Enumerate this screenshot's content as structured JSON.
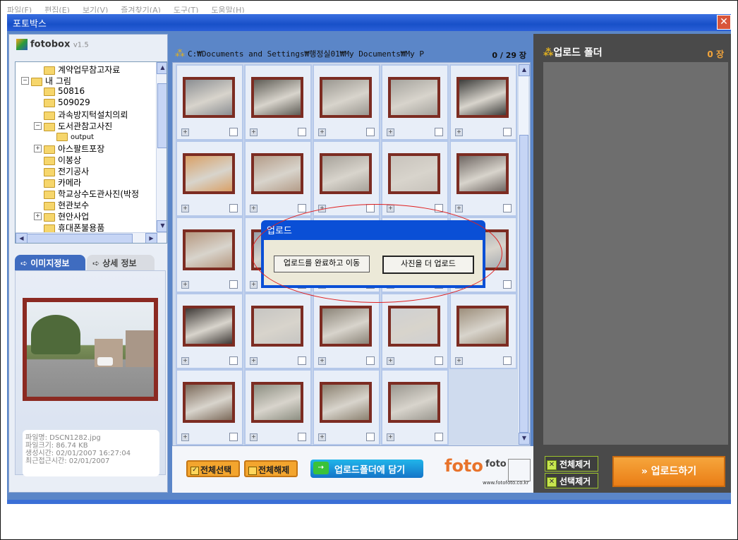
{
  "menubar": {
    "items": [
      "파일(F)",
      "편집(E)",
      "보기(V)",
      "즐겨찾기(A)",
      "도구(T)",
      "도움말(H)"
    ]
  },
  "window": {
    "title": "포토박스",
    "close_glyph": "✕"
  },
  "logo": {
    "name": "fotobox",
    "version": "v1.5"
  },
  "tree": {
    "items": [
      {
        "label": "계약업무참고자료",
        "indent": 2,
        "expander": ""
      },
      {
        "label": "내 그림",
        "indent": 1,
        "expander": "−"
      },
      {
        "label": "50816",
        "indent": 2,
        "expander": ""
      },
      {
        "label": "509029",
        "indent": 2,
        "expander": ""
      },
      {
        "label": "과속방지턱설치의뢰",
        "indent": 2,
        "expander": ""
      },
      {
        "label": "도서관참고사진",
        "indent": 2,
        "expander": "−"
      },
      {
        "label": "output",
        "indent": 3,
        "expander": ""
      },
      {
        "label": "아스팔트포장",
        "indent": 2,
        "expander": "+"
      },
      {
        "label": "이봉상",
        "indent": 2,
        "expander": ""
      },
      {
        "label": "전기공사",
        "indent": 2,
        "expander": ""
      },
      {
        "label": "카메라",
        "indent": 2,
        "expander": ""
      },
      {
        "label": "학교상수도관사진(박정",
        "indent": 2,
        "expander": ""
      },
      {
        "label": "현관보수",
        "indent": 2,
        "expander": ""
      },
      {
        "label": "현안사업",
        "indent": 2,
        "expander": "+"
      },
      {
        "label": "휴대폰불용품",
        "indent": 2,
        "expander": ""
      }
    ]
  },
  "tabs": {
    "image_info": "이미지정보",
    "detail_info": "상세 정보"
  },
  "file_info": {
    "name_label": "파일명:",
    "name": "DSCN1282.jpg",
    "size_label": "파일크기:",
    "size": "86.74 KB",
    "created_label": "생성시간:",
    "created": "02/01/2007 16:27:04",
    "accessed_label": "최근접근시간:",
    "accessed": "02/01/2007"
  },
  "center": {
    "path": "C:₩Documents and Settings₩행정실01₩My Documents₩My P",
    "count": "0 / 29 장"
  },
  "thumbnails": {
    "colors": [
      [
        "#8b8e92",
        "#5e5c55",
        "#9a9790",
        "#a5a39d",
        "#3d3d3b"
      ],
      [
        "#d9a066",
        "#b49c88",
        "#a7a29a",
        "#c8c3bc",
        "#6f6763"
      ],
      [
        "#b69880",
        "#99a0a8",
        "#9fa8b2",
        "#8f98a2",
        "#a5aab0"
      ],
      [
        "#3f3a37",
        "#c6c5c2",
        "#8b8478",
        "#cfd0d2",
        "#9d8f7c"
      ],
      [
        "#7c6a5a",
        "#8d8f82",
        "#8b8170",
        "#9a978f"
      ]
    ]
  },
  "bottom": {
    "select_all": "전체선택",
    "deselect_all": "전체해제",
    "add_to_upload": "업로드폴더에 담기",
    "brand": "foto",
    "brand_small": "foto",
    "brand_url": "www.fotofoto.co.kr"
  },
  "right": {
    "title": "업로드 폴더",
    "count": "0 장",
    "remove_all": "전체제거",
    "remove_selected": "선택제거",
    "upload": "업로드하기"
  },
  "dialog": {
    "title": "업로드",
    "btn_complete": "업로드를 완료하고 이동",
    "btn_more": "사진을 더 업로드"
  }
}
